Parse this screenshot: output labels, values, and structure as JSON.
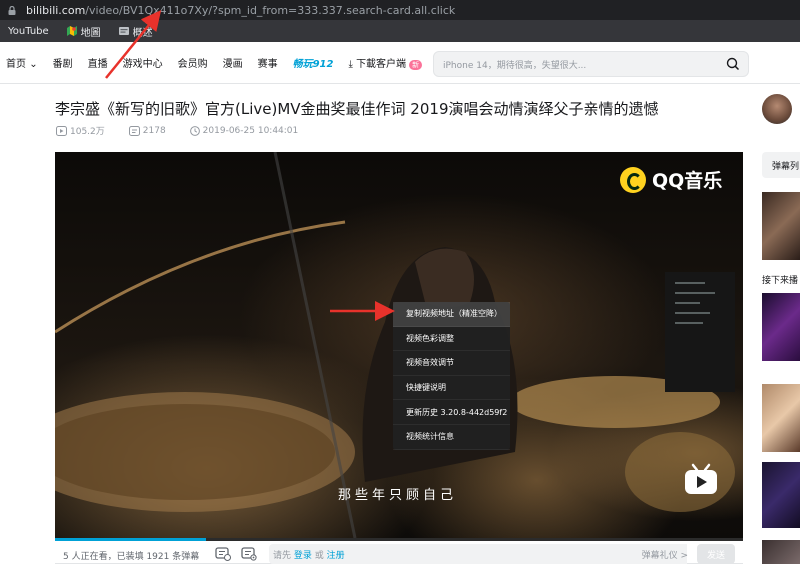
{
  "browser": {
    "url_host": "bilibili.com",
    "url_path": "/video/BV1Qx411o7Xy/?spm_id_from=333.337.search-card.all.click",
    "bookmarks": [
      {
        "label": "YouTube"
      },
      {
        "label": "地圖"
      },
      {
        "label": "概述"
      }
    ]
  },
  "nav": {
    "items": [
      "首页",
      "番剧",
      "直播",
      "游戏中心",
      "会员购",
      "漫画",
      "赛事"
    ],
    "game_label": "畅玩912",
    "download_label": "下載客户端",
    "download_badge": "新",
    "search_placeholder": "iPhone 14，期待很高，失望很大..."
  },
  "video": {
    "title": "李宗盛《新写的旧歌》官方(Live)MV金曲奖最佳作词 2019演唱会动情演绎父子亲情的遗憾",
    "views": "105.2万",
    "danmaku_count": "2178",
    "date": "2019-06-25 10:44:01",
    "watermark": "QQ音乐",
    "subtitle": "那些年只顾自己",
    "progress": 0.22
  },
  "context_menu": {
    "items": [
      "复制视频地址（精准空降）",
      "视频色彩调整",
      "视频音效调节",
      "快捷键说明",
      "更新历史 3.20.8-442d59f2",
      "视频统计信息"
    ]
  },
  "danmaku_bar": {
    "viewers": "5 人正在看，已装填 1921 条弹幕",
    "prompt_prefix": "请先",
    "login": "登录",
    "or": "或",
    "register": "注册",
    "etiquette": "弹幕礼仪 >",
    "send": "发送"
  },
  "right_panel": {
    "danmaku_tab": "弹幕列",
    "next_label": "接下来播"
  },
  "colors": {
    "accent": "#00a1d6",
    "pink": "#fb7299",
    "annotation": "#e8322b"
  }
}
